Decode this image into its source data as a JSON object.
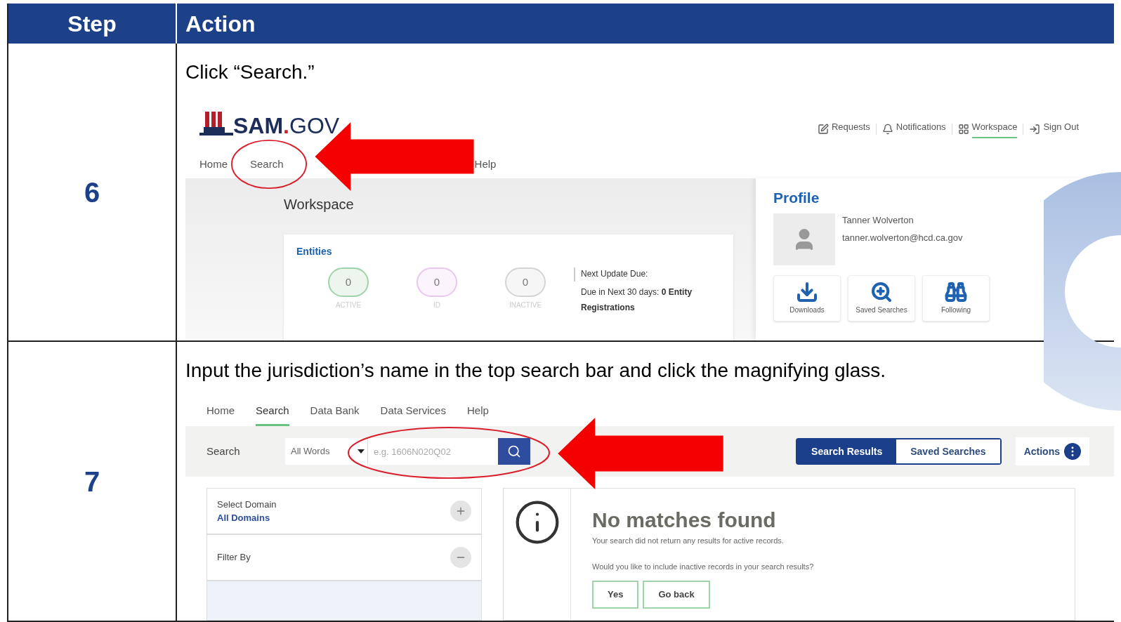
{
  "table": {
    "columns": [
      "Step",
      "Action"
    ],
    "rows": [
      {
        "step": "6",
        "instruction": "Click “Search.”",
        "screenshot": {
          "logo": {
            "main": "SAM",
            "dot": ".",
            "tail": "GOV"
          },
          "top_links": [
            {
              "label": "Requests",
              "kind": "edit",
              "selected": false
            },
            {
              "label": "Notifications",
              "kind": "bell",
              "selected": false
            },
            {
              "label": "Workspace",
              "kind": "grid",
              "selected": true
            },
            {
              "label": "Sign Out",
              "kind": "exit",
              "selected": false
            }
          ],
          "nav": [
            "Home",
            "Search",
            "Help"
          ],
          "page_title": "Workspace",
          "entities": {
            "title": "Entities",
            "counters": [
              {
                "value": "0",
                "label": "ACTIVE",
                "color": "#9fd3a9"
              },
              {
                "value": "0",
                "label": "ID",
                "color": "#e9c6ef"
              },
              {
                "value": "0",
                "label": "INACTIVE",
                "color": "#d4d4d4"
              }
            ],
            "next_update": "Next Update Due:",
            "due": "Due in Next 30 days: **0 Entity Registrations**"
          },
          "profile": {
            "title": "Profile",
            "name": "Tanner Wolverton",
            "email": "tanner.wolverton@hcd.ca.gov",
            "tiles": [
              {
                "label": "Downloads",
                "kind": "download"
              },
              {
                "label": "Saved Searches",
                "kind": "zoom"
              },
              {
                "label": "Following",
                "kind": "binoculars"
              }
            ]
          }
        }
      },
      {
        "step": "7",
        "instruction": "Input the jurisdiction’s name in the top search bar and click the magnifying glass.",
        "screenshot": {
          "nav": [
            {
              "label": "Home",
              "selected": false
            },
            {
              "label": "Search",
              "selected": true
            },
            {
              "label": "Data Bank",
              "selected": false
            },
            {
              "label": "Data Services",
              "selected": false
            },
            {
              "label": "Help",
              "selected": false
            }
          ],
          "search": {
            "label": "Search",
            "mode": "All Words",
            "placeholder": "e.g. 1606N020Q02"
          },
          "views": [
            {
              "label": "Search Results",
              "selected": true
            },
            {
              "label": "Saved Searches",
              "selected": false
            }
          ],
          "actions": "Actions",
          "filters": [
            {
              "label": "Select Domain",
              "value": "All Domains",
              "expanded": false
            },
            {
              "label": "Filter By",
              "expanded": true
            }
          ],
          "result": {
            "title": "No matches found",
            "message": "Your search did not return any results for active records.",
            "question": "Would you like to include inactive records in your search results?",
            "buttons": [
              "Yes",
              "Go back"
            ]
          }
        }
      }
    ]
  }
}
